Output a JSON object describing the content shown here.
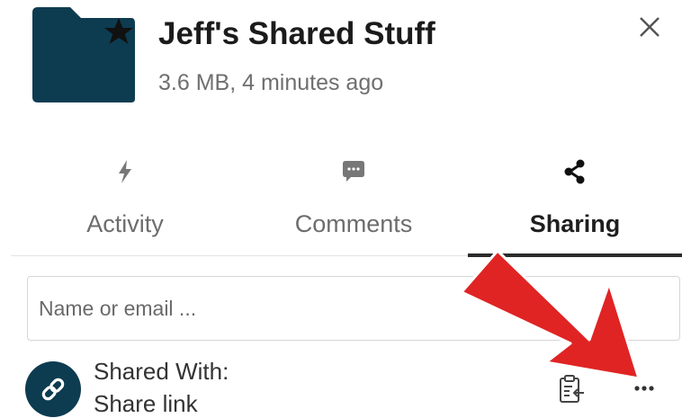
{
  "header": {
    "title": "Jeff's Shared Stuff",
    "subtitle": "3.6 MB, 4 minutes ago",
    "folder_icon": "folder-star-icon",
    "close_icon": "close-icon"
  },
  "tabs": [
    {
      "label": "Activity",
      "icon": "lightning-icon",
      "active": false
    },
    {
      "label": "Comments",
      "icon": "comment-icon",
      "active": false
    },
    {
      "label": "Sharing",
      "icon": "share-icon",
      "active": true
    }
  ],
  "sharing": {
    "input_placeholder": "Name or email ...",
    "input_value": "",
    "entries": [
      {
        "line1": "Shared With:",
        "line2": "Share link",
        "icon": "link-icon"
      }
    ]
  },
  "colors": {
    "folder": "#0d3c51",
    "annotation_arrow": "#e02424",
    "active_tab_underline": "#2b2b2b"
  }
}
